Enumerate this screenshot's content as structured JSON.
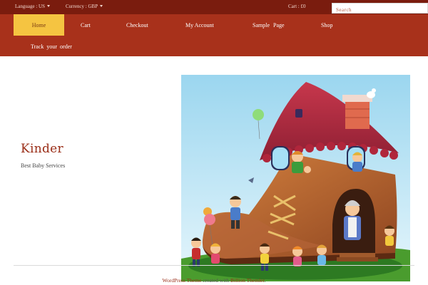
{
  "topbar": {
    "language": "Language : US",
    "currency": "Currency : GBP",
    "cart": "Cart : £0",
    "search_placeholder": "Search"
  },
  "nav": {
    "items": [
      "Home",
      "Cart",
      "Checkout",
      "My Account",
      "Sample Page",
      "Shop",
      "Track your order"
    ]
  },
  "site": {
    "title": "Kinder",
    "subtitle": "Best Baby Services"
  },
  "footer": {
    "prefix": "WordPress Theme",
    "middle": " created with ",
    "link": "Billion Themler",
    "suffix": "."
  },
  "colors": {
    "topbar": "#7a1c0e",
    "navbar": "#a8311b",
    "nav_active": "#f5c441",
    "title": "#9a2d17"
  },
  "icons": [
    "caret-down-icon"
  ]
}
